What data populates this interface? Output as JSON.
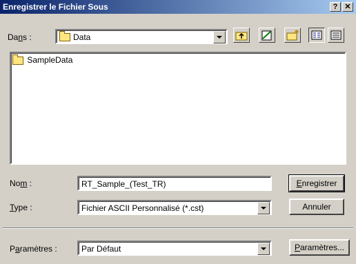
{
  "window": {
    "title": "Enregistrer le Fichier Sous",
    "help_label": "?",
    "close_label": "✕"
  },
  "location": {
    "label_pre": "Da",
    "label_u": "n",
    "label_post": "s :",
    "value": "Data"
  },
  "toolbar": {
    "up": "folder-up-icon",
    "explore": "explore-icon",
    "new_folder": "new-folder-icon",
    "list_view": "list-view-icon",
    "details_view": "details-view-icon"
  },
  "files": [
    {
      "name": "SampleData",
      "icon": "folder-icon"
    }
  ],
  "name_field": {
    "label_pre": "No",
    "label_u": "m",
    "label_post": " :",
    "value": "RT_Sample_(Test_TR)"
  },
  "type_field": {
    "label_u": "T",
    "label_post": "ype :",
    "value": "Fichier ASCII Personnalisé (*.cst)"
  },
  "params_field": {
    "label_pre": "P",
    "label_u": "a",
    "label_post": "ramètres :",
    "value": "Par Défaut"
  },
  "buttons": {
    "save_u": "E",
    "save_rest": "nregistrer",
    "cancel": "Annuler",
    "params_u": "P",
    "params_rest": "aramètres..."
  },
  "colors": {
    "title_start": "#0a246a",
    "title_end": "#a6caf0",
    "face": "#d4d0c8"
  }
}
